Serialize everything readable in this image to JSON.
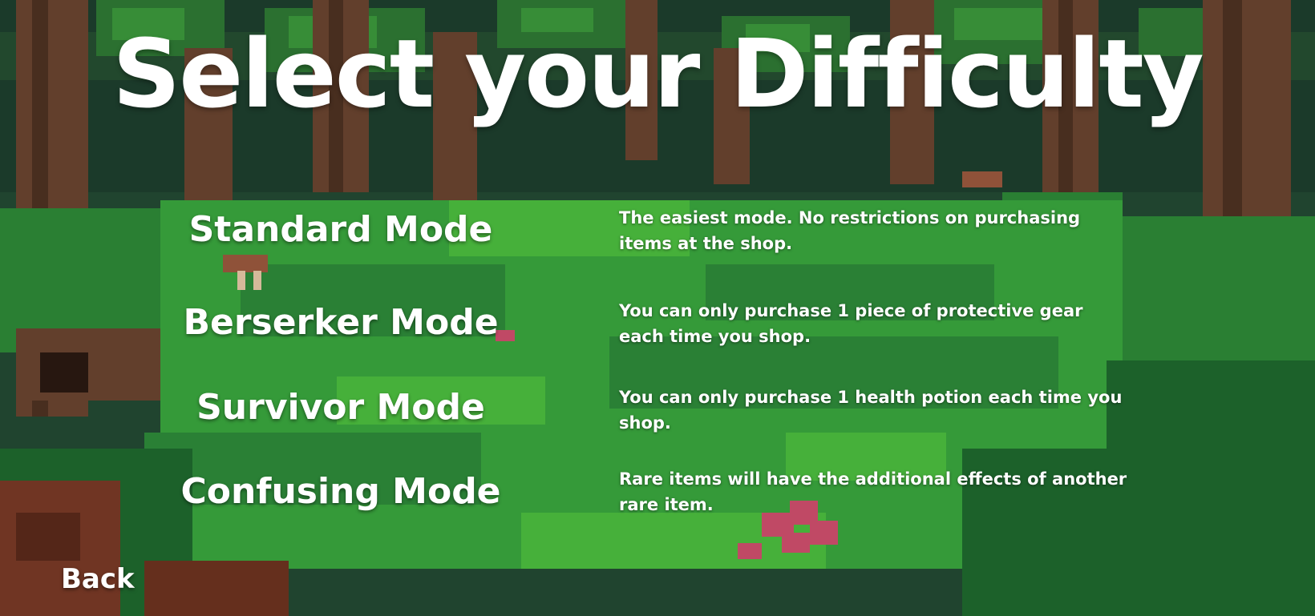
{
  "screen": {
    "title": "Select your Difficulty",
    "colors": {
      "text": "#ffffff",
      "forest_dark": "#1f4a2a",
      "grass_light": "#4cbf3f",
      "tree_bark": "#6b4530",
      "mushroom": "#d1506e"
    }
  },
  "modes": [
    {
      "label": "Standard Mode",
      "description": "The easiest mode. No restrictions on purchasing items at the shop."
    },
    {
      "label": "Berserker Mode",
      "description": "You can only purchase 1 piece of protective gear each time you shop."
    },
    {
      "label": "Survivor Mode",
      "description": "You can only purchase 1 health potion each time you shop."
    },
    {
      "label": "Confusing Mode",
      "description": "Rare items will have the additional effects of another rare item."
    }
  ],
  "navigation": {
    "back_label": "Back"
  }
}
